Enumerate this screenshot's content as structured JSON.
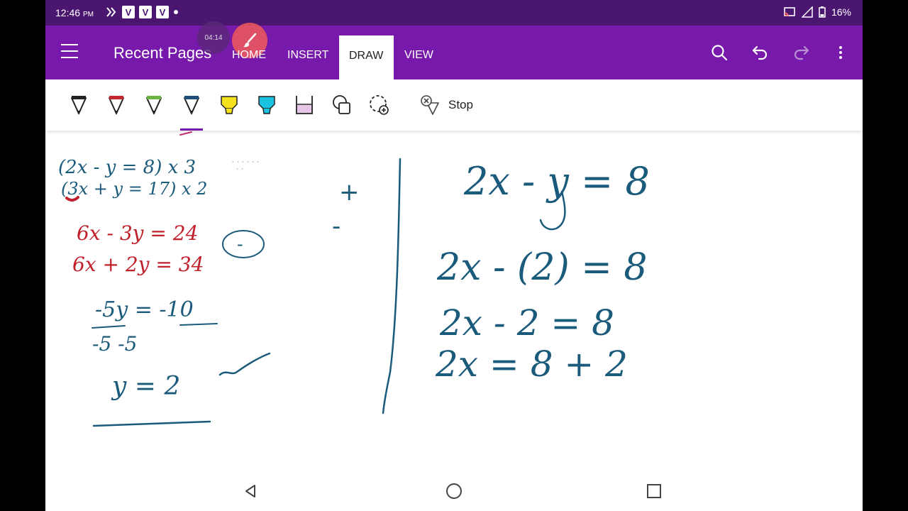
{
  "status": {
    "time": "12:46",
    "time_suffix": "PM",
    "badges": [
      "V",
      "V",
      "V"
    ],
    "battery": "16%"
  },
  "recorder": {
    "elapsed": "04:14"
  },
  "app": {
    "title": "Recent Pages"
  },
  "tabs": [
    {
      "label": "HOME",
      "active": false
    },
    {
      "label": "INSERT",
      "active": false
    },
    {
      "label": "DRAW",
      "active": true
    },
    {
      "label": "VIEW",
      "active": false
    }
  ],
  "toolbar": {
    "stop_label": "Stop",
    "pens": [
      {
        "name": "black-pen-icon",
        "color": "#222222"
      },
      {
        "name": "red-pen-icon",
        "color": "#c0282d"
      },
      {
        "name": "green-pen-icon",
        "color": "#6db33f"
      },
      {
        "name": "blue-pen-icon",
        "color": "#1f4e79"
      },
      {
        "name": "yellow-highlighter-icon",
        "color": "#f5e11b"
      },
      {
        "name": "cyan-highlighter-icon",
        "color": "#19c3e0"
      },
      {
        "name": "pink-highlighter-icon",
        "color": "#e8c6e8"
      }
    ]
  },
  "colors": {
    "status_bar": "#4b1670",
    "app_bar": "#7719aa",
    "ink_blue": "#1a5a7a",
    "ink_red": "#c0202a"
  },
  "ink": {
    "left_work": {
      "line1": "(2x - y = 8) x 3",
      "line2": "(3x + y = 17) x 2",
      "line3": "6x - 3y = 24",
      "line4": "6x + 2y = 34",
      "sign": "-",
      "line5": "-5y = -10",
      "line6": "-5      -5",
      "result": "y = 2"
    },
    "middle_signs": [
      "+",
      "-"
    ],
    "right_work": {
      "line1": "2x - y = 8",
      "line2": "2x - (2) = 8",
      "line3": "2x - 2 = 8",
      "line4": "2x = 8 + 2"
    }
  }
}
